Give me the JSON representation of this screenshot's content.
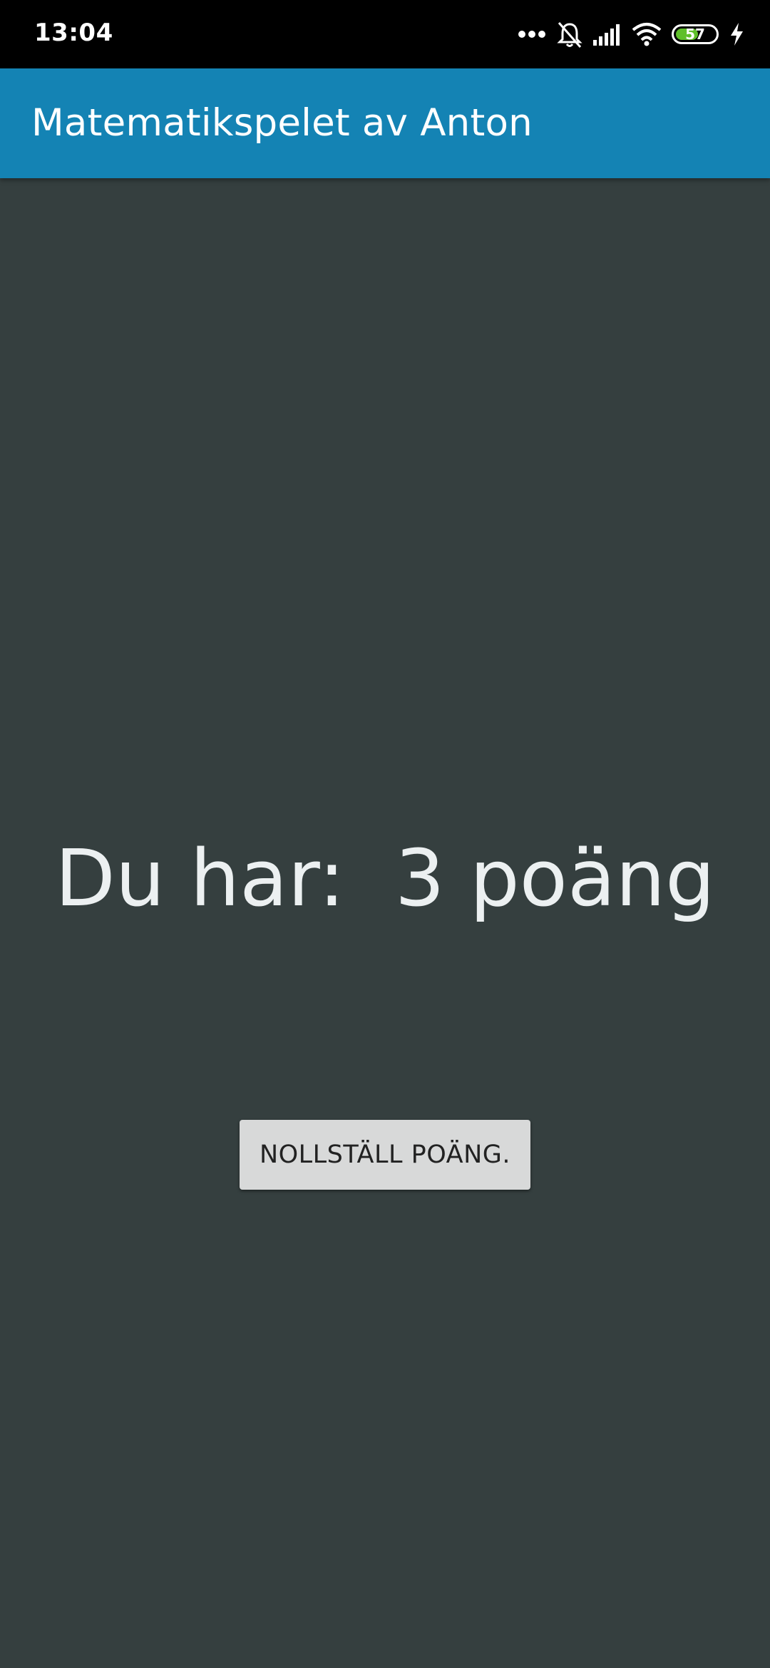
{
  "status_bar": {
    "time": "13:04",
    "icons": [
      "more-dots-icon",
      "muted-bell-icon",
      "signal-icon",
      "wifi-icon",
      "battery-icon",
      "charging-icon"
    ],
    "battery_level": "57",
    "battery_fraction": 0.57,
    "battery_color": "#5fbf2a"
  },
  "app_bar": {
    "title": "Matematikspelet av Anton",
    "color": "#1483b4"
  },
  "main": {
    "score_text": "Du har:  3 poäng",
    "reset_label": "NOLLSTÄLL POÄNG.",
    "background": "#353f3f"
  }
}
